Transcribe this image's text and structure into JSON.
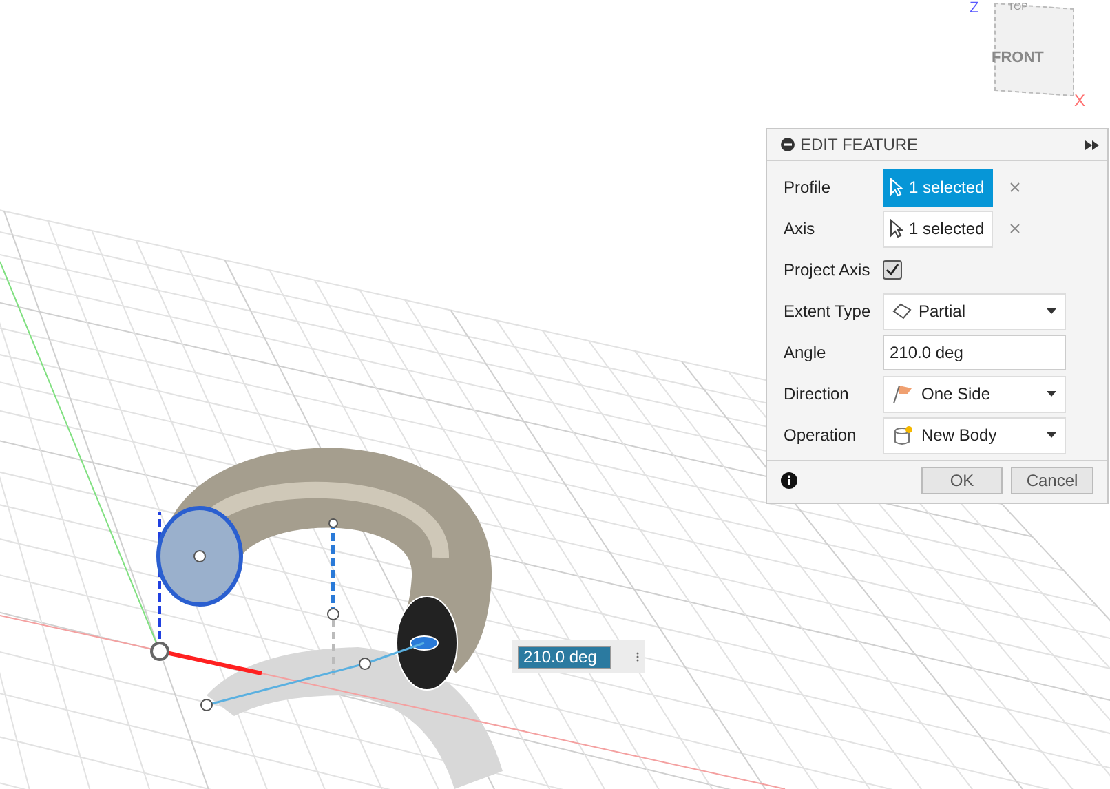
{
  "view_cube": {
    "top": "TOP",
    "front": "FRONT",
    "z_axis": "Z",
    "x_axis": "X"
  },
  "panel": {
    "title": "EDIT FEATURE",
    "rows": [
      {
        "kind": "selection",
        "label": "Profile",
        "value": "1 selected",
        "selected": true
      },
      {
        "kind": "selection",
        "label": "Axis",
        "value": "1 selected",
        "selected": false
      },
      {
        "kind": "checkbox",
        "label": "Project Axis",
        "checked": true
      },
      {
        "kind": "dropdown",
        "label": "Extent Type",
        "value": "Partial"
      },
      {
        "kind": "text",
        "label": "Angle",
        "value": "210.0 deg"
      },
      {
        "kind": "dropdown",
        "label": "Direction",
        "value": "One Side"
      },
      {
        "kind": "dropdown",
        "label": "Operation",
        "value": "New Body"
      }
    ],
    "buttons": [
      "OK",
      "Cancel"
    ]
  },
  "angle_input": {
    "value": "210.0 deg"
  }
}
